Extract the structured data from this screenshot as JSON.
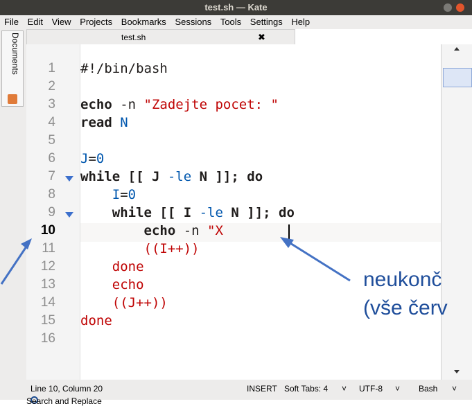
{
  "window": {
    "title": "test.sh — Kate"
  },
  "menu": [
    "File",
    "Edit",
    "View",
    "Projects",
    "Bookmarks",
    "Sessions",
    "Tools",
    "Settings",
    "Help"
  ],
  "sidebar": {
    "documents_label": "Documents"
  },
  "tab": {
    "label": "test.sh",
    "close_glyph": "✖"
  },
  "editor": {
    "line_numbers": [
      "1",
      "2",
      "3",
      "4",
      "5",
      "6",
      "7",
      "8",
      "9",
      "10",
      "11",
      "12",
      "13",
      "14",
      "15",
      "16"
    ],
    "current_line": "10"
  },
  "status": {
    "position": "Line 10, Column 20",
    "mode": "INSERT",
    "indent": "Soft Tabs: 4",
    "encoding": "UTF-8",
    "syntax": "Bash",
    "dropdown_glyph": "˅"
  },
  "search_bar": {
    "label": "Search and Replace"
  },
  "annotation": {
    "line1": "neukonč",
    "line2": "(vše červ"
  },
  "colors": {
    "keyword": "#1f1c1b",
    "variable": "#0057ae",
    "string": "#bf0303",
    "arrow": "#4472c4"
  }
}
